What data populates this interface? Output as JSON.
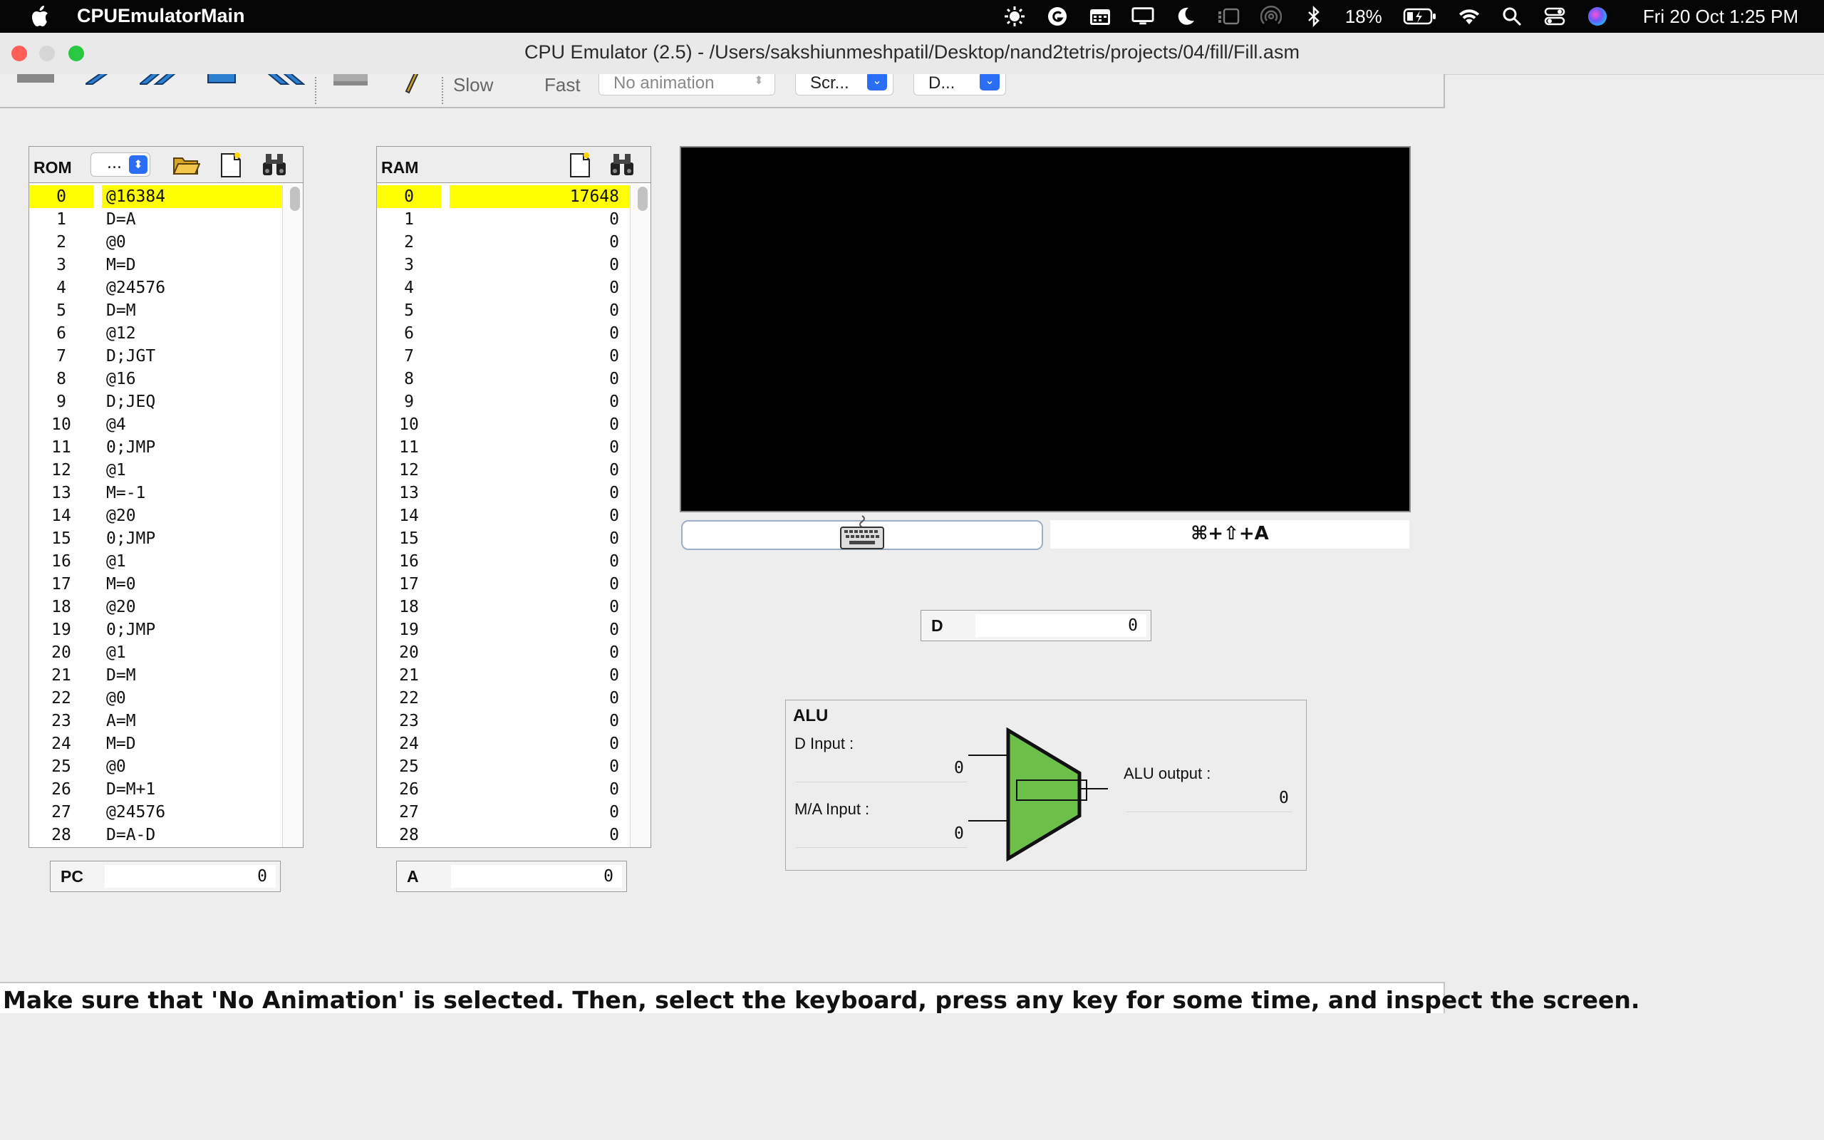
{
  "menubar": {
    "app_name": "CPUEmulatorMain",
    "battery": "18%",
    "clock": "Fri 20 Oct  1:25 PM",
    "icons": [
      "apple-icon",
      "sun-icon",
      "grammarly-icon",
      "calendar-icon",
      "display-icon",
      "moon-icon",
      "stage-icon",
      "airdrop-icon",
      "bluetooth-icon",
      "battery-icon",
      "wifi-icon",
      "search-icon",
      "control-center-icon",
      "siri-icon"
    ]
  },
  "window": {
    "title": "CPU Emulator (2.5) - /Users/sakshiunmeshpatil/Desktop/nand2tetris/projects/04/fill/Fill.asm"
  },
  "toolbar": {
    "slow_label": "Slow",
    "fast_label": "Fast",
    "animation_select": "No animation",
    "view_select": "Scr...",
    "format_select": "D..."
  },
  "rom": {
    "title": "ROM",
    "format_select": "...",
    "rows": [
      {
        "i": "0",
        "v": "@16384"
      },
      {
        "i": "1",
        "v": "D=A"
      },
      {
        "i": "2",
        "v": "@0"
      },
      {
        "i": "3",
        "v": "M=D"
      },
      {
        "i": "4",
        "v": "@24576"
      },
      {
        "i": "5",
        "v": "D=M"
      },
      {
        "i": "6",
        "v": "@12"
      },
      {
        "i": "7",
        "v": "D;JGT"
      },
      {
        "i": "8",
        "v": "@16"
      },
      {
        "i": "9",
        "v": "D;JEQ"
      },
      {
        "i": "10",
        "v": "@4"
      },
      {
        "i": "11",
        "v": "0;JMP"
      },
      {
        "i": "12",
        "v": "@1"
      },
      {
        "i": "13",
        "v": "M=-1"
      },
      {
        "i": "14",
        "v": "@20"
      },
      {
        "i": "15",
        "v": "0;JMP"
      },
      {
        "i": "16",
        "v": "@1"
      },
      {
        "i": "17",
        "v": "M=0"
      },
      {
        "i": "18",
        "v": "@20"
      },
      {
        "i": "19",
        "v": "0;JMP"
      },
      {
        "i": "20",
        "v": "@1"
      },
      {
        "i": "21",
        "v": "D=M"
      },
      {
        "i": "22",
        "v": "@0"
      },
      {
        "i": "23",
        "v": "A=M"
      },
      {
        "i": "24",
        "v": "M=D"
      },
      {
        "i": "25",
        "v": "@0"
      },
      {
        "i": "26",
        "v": "D=M+1"
      },
      {
        "i": "27",
        "v": "@24576"
      },
      {
        "i": "28",
        "v": "D=A-D"
      }
    ]
  },
  "ram": {
    "title": "RAM",
    "rows": [
      {
        "i": "0",
        "v": "17648"
      },
      {
        "i": "1",
        "v": "0"
      },
      {
        "i": "2",
        "v": "0"
      },
      {
        "i": "3",
        "v": "0"
      },
      {
        "i": "4",
        "v": "0"
      },
      {
        "i": "5",
        "v": "0"
      },
      {
        "i": "6",
        "v": "0"
      },
      {
        "i": "7",
        "v": "0"
      },
      {
        "i": "8",
        "v": "0"
      },
      {
        "i": "9",
        "v": "0"
      },
      {
        "i": "10",
        "v": "0"
      },
      {
        "i": "11",
        "v": "0"
      },
      {
        "i": "12",
        "v": "0"
      },
      {
        "i": "13",
        "v": "0"
      },
      {
        "i": "14",
        "v": "0"
      },
      {
        "i": "15",
        "v": "0"
      },
      {
        "i": "16",
        "v": "0"
      },
      {
        "i": "17",
        "v": "0"
      },
      {
        "i": "18",
        "v": "0"
      },
      {
        "i": "19",
        "v": "0"
      },
      {
        "i": "20",
        "v": "0"
      },
      {
        "i": "21",
        "v": "0"
      },
      {
        "i": "22",
        "v": "0"
      },
      {
        "i": "23",
        "v": "0"
      },
      {
        "i": "24",
        "v": "0"
      },
      {
        "i": "25",
        "v": "0"
      },
      {
        "i": "26",
        "v": "0"
      },
      {
        "i": "27",
        "v": "0"
      },
      {
        "i": "28",
        "v": "0"
      }
    ]
  },
  "registers": {
    "pc_label": "PC",
    "pc_value": "0",
    "a_label": "A",
    "a_value": "0",
    "d_label": "D",
    "d_value": "0"
  },
  "keyboard": {
    "shortcut": "⌘+⇧+A"
  },
  "alu": {
    "title": "ALU",
    "d_input_label": "D Input :",
    "d_input_value": "0",
    "ma_input_label": "M/A Input :",
    "ma_input_value": "0",
    "output_label": "ALU output :",
    "output_value": "0"
  },
  "status": {
    "message": "Make sure that 'No Animation' is selected. Then, select the keyboard, press any key for some time, and inspect the screen."
  },
  "colors": {
    "highlight": "#ffff00",
    "alu_green": "#6cc04a",
    "select_blue": "#2a6ef5",
    "screen": "#000000"
  }
}
